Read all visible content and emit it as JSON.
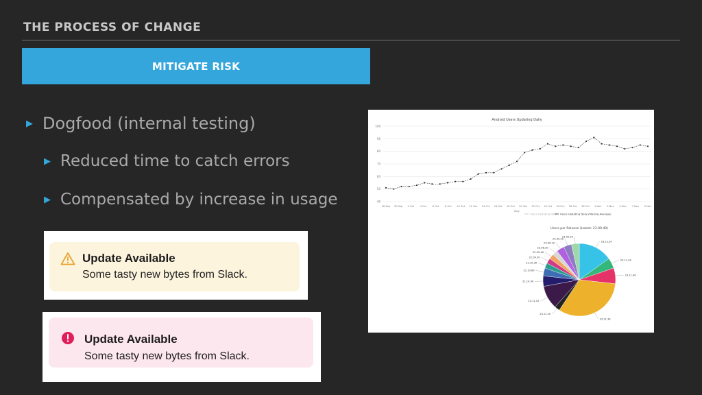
{
  "slide": {
    "heading": "THE PROCESS OF CHANGE",
    "banner": "MITIGATE RISK",
    "bullets": [
      "Dogfood (internal testing)",
      "Reduced time to catch errors",
      "Compensated by increase in usage"
    ]
  },
  "notices": [
    {
      "title": "Update Available",
      "body": "Some tasty new bytes from Slack.",
      "icon": "warning-icon",
      "bg": "#fcf4dd",
      "accent": "#e8a22c"
    },
    {
      "title": "Update Available",
      "body": "Some tasty new bytes from Slack.",
      "icon": "error-icon",
      "bg": "#fde7ee",
      "accent": "#e01e5a"
    }
  ],
  "colors": {
    "background": "#262626",
    "banner": "#34a6db",
    "bullet_marker": "#34a6db"
  },
  "chart_data": [
    {
      "type": "line",
      "title": "Android Users Updating Daily",
      "xlabel": "Day",
      "x": [
        "28 Sep",
        "30 Sep",
        "2 Oct",
        "4 Oct",
        "6 Oct",
        "8 Oct",
        "10 Oct",
        "12 Oct",
        "14 Oct",
        "16 Oct",
        "18 Oct",
        "20 Oct",
        "22 Oct",
        "24 Oct",
        "26 Oct",
        "28 Oct",
        "30 Oct",
        "1 Nov",
        "3 Nov",
        "5 Nov",
        "7 Nov",
        "9 Nov"
      ],
      "x_ticks_show_every": 1,
      "ylim": [
        40,
        100
      ],
      "yticks": [
        40,
        50,
        60,
        70,
        80,
        90,
        100
      ],
      "series": [
        {
          "name": "Users Updating Daily (Moving Average)",
          "values": [
            51,
            50,
            52,
            52,
            53,
            55,
            54,
            54,
            55,
            56,
            56,
            58,
            62,
            63,
            63,
            66,
            69,
            72,
            79,
            81,
            82,
            86,
            84,
            85,
            84,
            83,
            88,
            91,
            86,
            85,
            84,
            82,
            83,
            85,
            84
          ]
        }
      ],
      "legend": [
        "Users Updating Daily",
        "Users Updating Daily (Moving Average)"
      ],
      "legend_position": "bottom"
    },
    {
      "type": "pie",
      "title": "Users per Release (Latest: 23.09.40)",
      "labels": [
        "23.12.20",
        "23.11.44",
        "23.11.40",
        "23.11.30",
        "23.11.20",
        "23.11.10",
        "22.10.90",
        "22.10.60",
        "22.10.30",
        "22.09.20",
        "22.09.40",
        "23.08.30",
        "23.06.10",
        "23.05.20",
        "23.05.30"
      ],
      "values": [
        13,
        4,
        6,
        28,
        2,
        9,
        4,
        3,
        2,
        2,
        2,
        2,
        3,
        3,
        3
      ],
      "colors": [
        "#37c3e8",
        "#34b77a",
        "#e5336a",
        "#eeb12b",
        "#222222",
        "#3b1a4a",
        "#241d6e",
        "#3c6db5",
        "#2a9d8f",
        "#cf3b84",
        "#f4a261",
        "#d8d8d8",
        "#b061e0",
        "#8e7cc3",
        "#9fd8a8"
      ],
      "grid": false
    }
  ]
}
